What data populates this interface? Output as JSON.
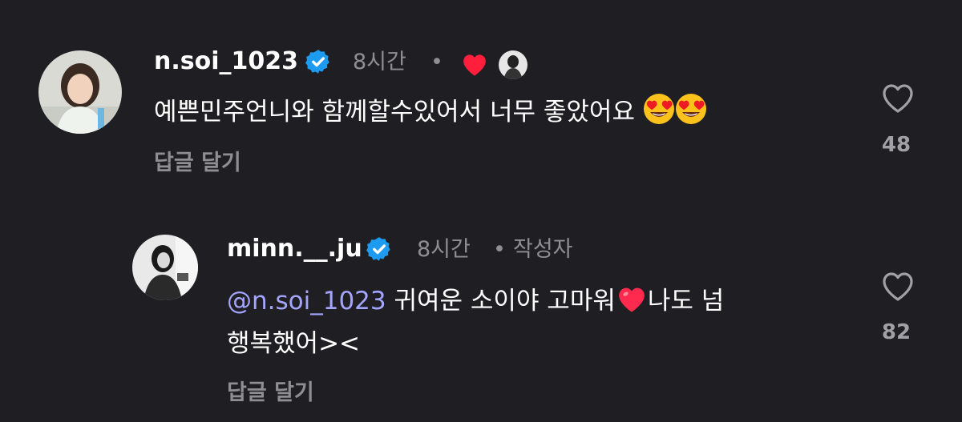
{
  "comments": [
    {
      "username": "n.soi_1023",
      "time": "8시간",
      "separator": "•",
      "text": "예쁜민주언니와 함께할수있어서 너무 좋았어요",
      "text_emoji": [
        "smiling-face-with-heart-eyes",
        "smiling-face-with-heart-eyes"
      ],
      "reply_label": "답글 달기",
      "likes": "48",
      "liked_by_creator": true
    },
    {
      "username": "minn.__.ju",
      "time": "8시간",
      "separator": "•",
      "author_badge": "작성자",
      "mention": "@n.soi_1023",
      "text_part1": "귀여운 소이야 고마워",
      "text_emoji": "red-heart",
      "text_part2": "나도 넘",
      "text_line2": "행복했어><",
      "reply_label": "답글 달기",
      "likes": "82"
    }
  ],
  "colors": {
    "background": "#1f1f23",
    "verified": "#1d9bf0",
    "mention": "#a3a5ff",
    "heart": "#ff1f3d",
    "muted": "#8e8e93"
  }
}
